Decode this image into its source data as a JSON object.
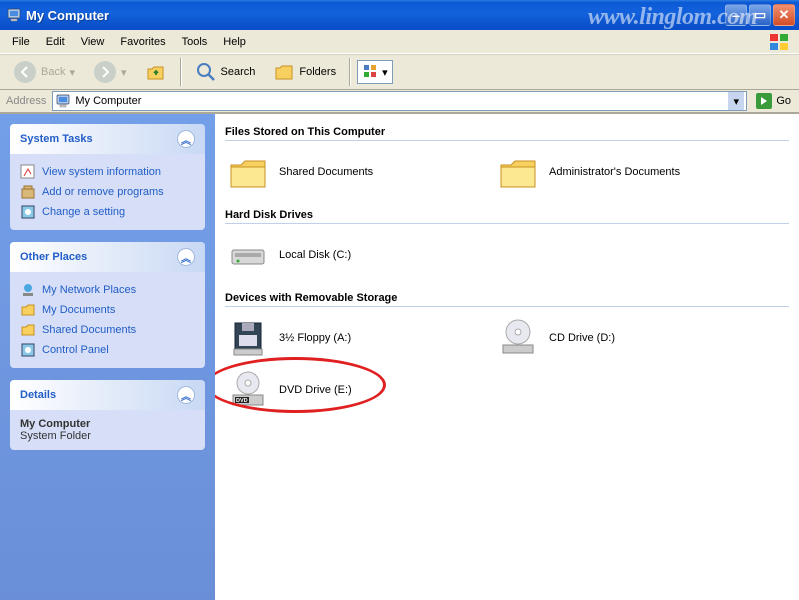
{
  "watermark": "www.linglom.com",
  "window": {
    "title": "My Computer"
  },
  "menubar": [
    "File",
    "Edit",
    "View",
    "Favorites",
    "Tools",
    "Help"
  ],
  "toolbar": {
    "back": "Back",
    "search": "Search",
    "folders": "Folders"
  },
  "address": {
    "label": "Address",
    "value": "My Computer",
    "go": "Go"
  },
  "sidebar": {
    "system_tasks": {
      "title": "System Tasks",
      "links": [
        "View system information",
        "Add or remove programs",
        "Change a setting"
      ]
    },
    "other_places": {
      "title": "Other Places",
      "links": [
        "My Network Places",
        "My Documents",
        "Shared Documents",
        "Control Panel"
      ]
    },
    "details": {
      "title": "Details",
      "name": "My Computer",
      "type": "System Folder"
    }
  },
  "content": {
    "sections": [
      {
        "title": "Files Stored on This Computer",
        "items": [
          {
            "label": "Shared Documents",
            "icon": "folder"
          },
          {
            "label": "Administrator's Documents",
            "icon": "folder"
          }
        ]
      },
      {
        "title": "Hard Disk Drives",
        "items": [
          {
            "label": "Local Disk (C:)",
            "icon": "hdd"
          }
        ]
      },
      {
        "title": "Devices with Removable Storage",
        "items": [
          {
            "label": "3½ Floppy (A:)",
            "icon": "floppy"
          },
          {
            "label": "CD Drive (D:)",
            "icon": "cd"
          },
          {
            "label": "DVD Drive (E:)",
            "icon": "dvd",
            "circled": true
          }
        ]
      }
    ]
  }
}
